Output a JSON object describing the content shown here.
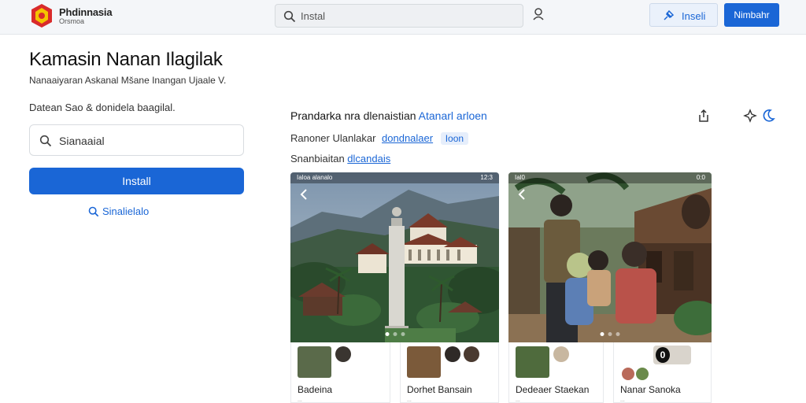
{
  "header": {
    "brand_title": "Phdinnasia",
    "brand_sub": "Orsmoa",
    "search_placeholder": "Instal",
    "outline_button_label": "Inseli",
    "primary_button_label": "Nimbahr"
  },
  "app": {
    "title": "Kamasin Nanan Ilagilak",
    "subtitle": "Nanaaiyaran Askanal Mšane Inangan Ujaale V.",
    "promo_text": "Datean Sao & donidela baagilal.",
    "search_value": "Sianaaial",
    "install_label": "Install",
    "secondary_link": "Sinalielalo"
  },
  "detail": {
    "title_strong": "Prandarka nra",
    "title_rest": "dlenaistian",
    "title_link": "Atanarl arloen",
    "meta_label": "Ranoner Ulanlakar",
    "meta_link": "dondnalaer",
    "meta_chip": "Ioon",
    "source_label": "Snanbiaitan",
    "source_link": "dlcandais"
  },
  "gallery": {
    "shot_a_status_left": "Ialoa alanalo",
    "shot_a_status_right": "12:3",
    "shot_b_status_left": "Ial0",
    "shot_b_status_right": "0:0",
    "captions": [
      {
        "title": "Badeina",
        "sub": "..."
      },
      {
        "title": "Dorhet Bansain",
        "sub": "..."
      },
      {
        "title": "Dedeaer Staekan",
        "sub": "..."
      },
      {
        "title": "Nanar Sanoka",
        "sub": "..."
      }
    ],
    "pill_label": "0"
  },
  "colors": {
    "accent": "#1a66d6",
    "topbar_bg": "#f4f6f9",
    "logo_red": "#d92b2b",
    "logo_yellow": "#f5c400"
  }
}
